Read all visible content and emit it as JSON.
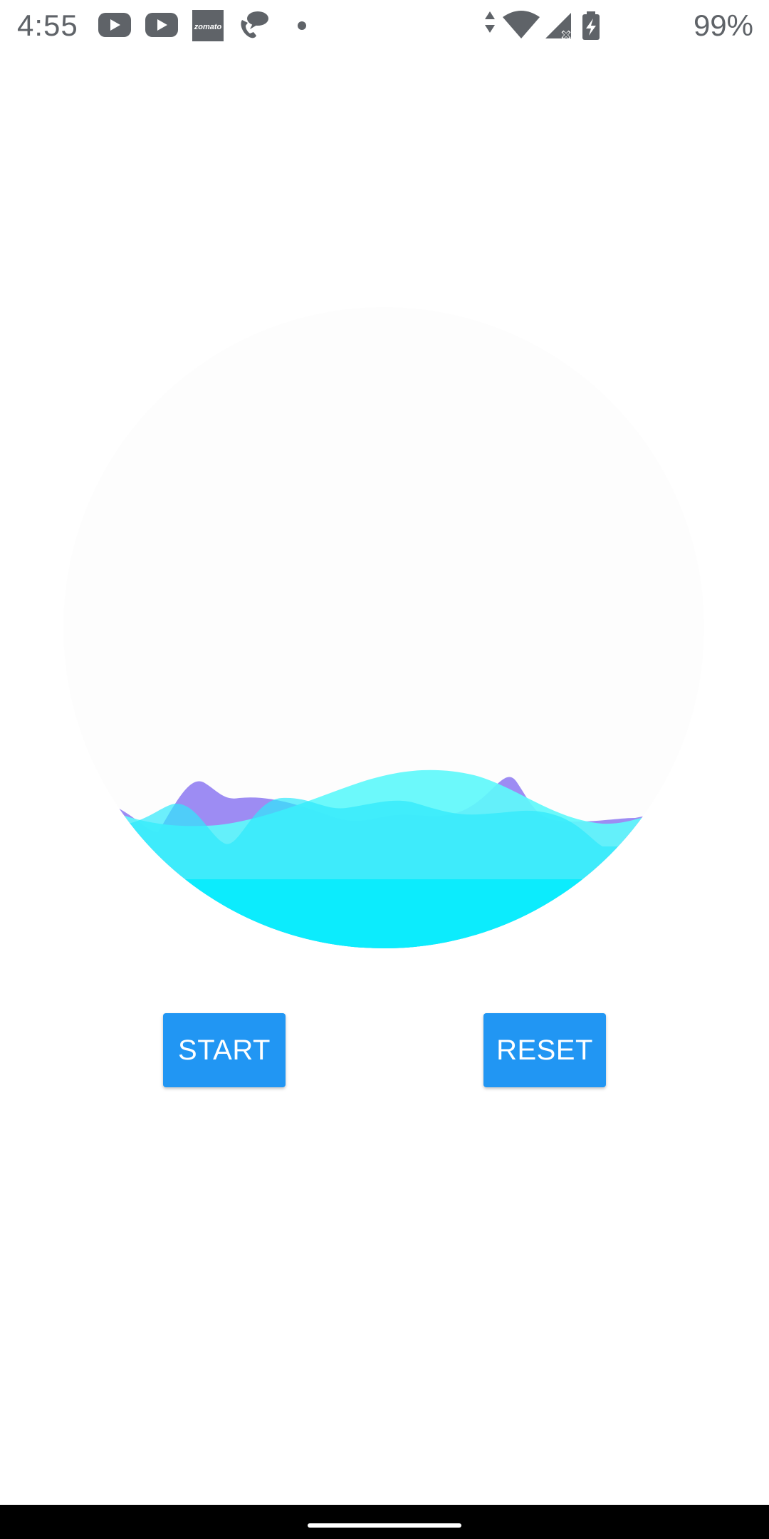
{
  "status_bar": {
    "time": "4:55",
    "battery": "99%",
    "notification_icons": [
      "youtube-icon",
      "youtube-icon",
      "zomato-icon",
      "chat-call-icon",
      "dot-icon"
    ],
    "zomato_label": "zomato",
    "system_icons": [
      "data-arrows-icon",
      "wifi-icon",
      "no-signal-icon",
      "battery-charging-icon"
    ]
  },
  "wave": {
    "colors": {
      "background_circle": "#fdfdfd",
      "purple": "#9d8cf3",
      "cyan_light": "#5ff8fb",
      "cyan_mid": "#2ee8fb",
      "cyan_deep": "#0cecfd"
    }
  },
  "buttons": {
    "start_label": "START",
    "reset_label": "RESET",
    "color": "#2196f3"
  }
}
